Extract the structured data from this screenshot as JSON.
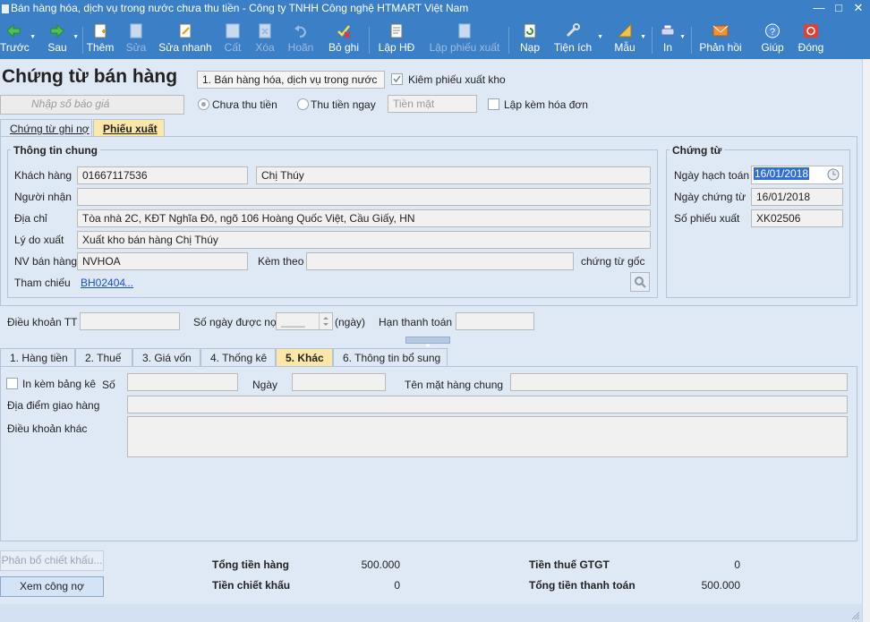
{
  "window": {
    "title": "Bán hàng hóa, dịch vụ trong nước chưa thu tiền - Công ty TNHH Công nghệ HTMART Việt Nam"
  },
  "toolbar": {
    "prev": "Trước",
    "next": "Sau",
    "add": "Thêm",
    "edit": "Sửa",
    "quick_edit": "Sửa nhanh",
    "save": "Cất",
    "delete": "Xóa",
    "undo": "Hoãn",
    "unpost": "Bỏ ghi",
    "create_invoice": "Lập HĐ",
    "create_export": "Lập phiếu xuất",
    "reload": "Nạp",
    "utilities": "Tiện ích",
    "template": "Mẫu",
    "print": "In",
    "feedback": "Phản hồi",
    "help": "Giúp",
    "close": "Đóng"
  },
  "header": {
    "title": "Chứng từ bán hàng",
    "voucher_type": "1. Bán hàng hóa, dịch vụ trong nước",
    "check_export": "Kiêm phiếu xuất kho",
    "quote_placeholder": "Nhập số báo giá",
    "unpaid": "Chưa thu tiền",
    "paid_now": "Thu tiền ngay",
    "payment_method": "Tiền mặt",
    "with_invoice": "Lập kèm hóa đơn"
  },
  "doc_tabs": [
    "Chứng từ ghi nợ",
    "Phiếu xuất"
  ],
  "general": {
    "title": "Thông tin chung",
    "customer_label": "Khách hàng",
    "customer_code": "01667117536",
    "customer_name": "Chị Thúy",
    "receiver_label": "Người nhận",
    "receiver": "",
    "address_label": "Địa chỉ",
    "address": "Tòa nhà 2C, KĐT Nghĩa Đô, ngõ 106 Hoàng Quốc Việt, Cầu Giấy, HN",
    "reason_label": "Lý do xuất",
    "reason": "Xuất kho bán hàng Chị Thúy",
    "sales_label": "NV bán hàng",
    "sales": "NVHOA",
    "attached_label": "Kèm theo",
    "attached": "",
    "orig_docs": "chứng từ gốc",
    "ref_label": "Tham chiếu",
    "ref_value": "BH02404",
    "ref_more": "..."
  },
  "voucher": {
    "title": "Chứng từ",
    "posting_date_label": "Ngày hạch toán",
    "posting_date": "16/01/2018",
    "doc_date_label": "Ngày chứng từ",
    "doc_date": "16/01/2018",
    "export_no_label": "Số phiếu xuất",
    "export_no": "XK02506"
  },
  "terms": {
    "payment_terms_label": "Điều khoản TT",
    "payment_terms": "",
    "days_label": "Số ngày được nợ",
    "days": "____",
    "days_unit": "(ngày)",
    "due_label": "Hạn thanh toán",
    "due": ""
  },
  "detail_tabs": [
    "1. Hàng tiền",
    "2. Thuế",
    "3. Giá vốn",
    "4. Thống kê",
    "5. Khác",
    "6. Thông tin bổ sung"
  ],
  "other": {
    "print_with_list": "In kèm bảng kê",
    "no_label": "Số",
    "no": "",
    "date_label": "Ngày",
    "date": "",
    "common_item_label": "Tên mặt hàng chung",
    "common_item": "",
    "delivery_label": "Địa điểm giao hàng",
    "delivery": "",
    "other_terms_label": "Điều khoản khác",
    "other_terms": ""
  },
  "footer": {
    "allocate_discount": "Phân bổ chiết khấu...",
    "view_debt": "Xem công nợ",
    "total_goods_label": "Tổng tiền hàng",
    "total_goods": "500.000",
    "discount_label": "Tiền chiết khấu",
    "discount": "0",
    "vat_label": "Tiền thuế GTGT",
    "vat": "0",
    "total_pay_label": "Tổng tiền thanh toán",
    "total_pay": "500.000"
  }
}
